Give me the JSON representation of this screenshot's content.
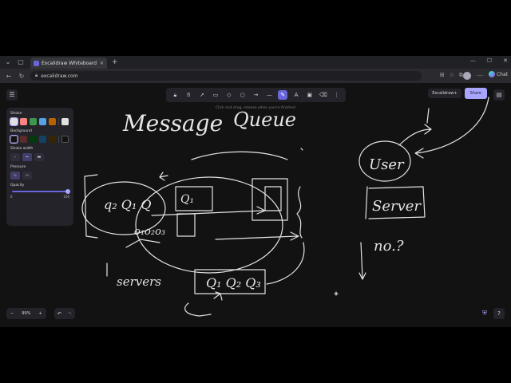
{
  "browser": {
    "tab_title": "Excalidraw Whiteboard",
    "url": "excalidraw.com",
    "copilot_label": "Chat"
  },
  "excalidraw": {
    "hint": "Click and drag, release when you're finished",
    "excalidraw_plus": "Excalidraw+",
    "share": "Share",
    "zoom": "99%",
    "properties": {
      "stroke_label": "Stroke",
      "stroke_colors": [
        "#e0e0e0",
        "#ff8383",
        "#3a994c",
        "#56a2e8",
        "#b76100"
      ],
      "stroke_current": "#e0e0e0",
      "background_label": "Background",
      "background_colors": [
        "#121212",
        "#5b2c2c",
        "#043b0c",
        "#154163",
        "#362600"
      ],
      "background_current": "#121212",
      "stroke_width_label": "Stroke width",
      "pressure_label": "Pressure",
      "opacity_label": "Opacity",
      "opacity_min": "0",
      "opacity_max": "100",
      "opacity_value": 100
    }
  },
  "sketch": {
    "title_word1": "Message",
    "title_word2": "Queue",
    "servers_label": "servers",
    "user_label": "User",
    "server_label": "Server",
    "no_label": "no.?",
    "q_items_a": "q₂ Q₁ Q",
    "q_items_b": "Q₁",
    "q_items_c": "o₁o₂o₃",
    "q_items_d": "Q₁ Q₂ Q₃"
  }
}
